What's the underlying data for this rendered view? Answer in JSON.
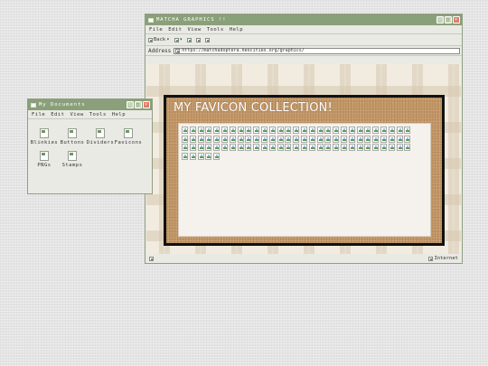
{
  "main_window": {
    "title": "MATCHA GRAPHICS !!",
    "menu": [
      "File",
      "Edit",
      "View",
      "Tools",
      "Help"
    ],
    "toolbar": {
      "back_label": "Back",
      "back_arrow": "▾",
      "fwd_arrow": "▾"
    },
    "address_label": "Address",
    "url": "https://matchadoptera.neocities.org/graphics/",
    "status_zone": "Internet"
  },
  "page": {
    "heading": "MY FAVICON COLLECTION!",
    "favicon_count": 92
  },
  "docs_window": {
    "title": "My Documents",
    "menu": [
      "File",
      "Edit",
      "View",
      "Tools",
      "Help"
    ],
    "folders": [
      "Blinkies",
      "Buttons",
      "Dividers",
      "Favicons",
      "PNGs",
      "Stamps"
    ]
  }
}
